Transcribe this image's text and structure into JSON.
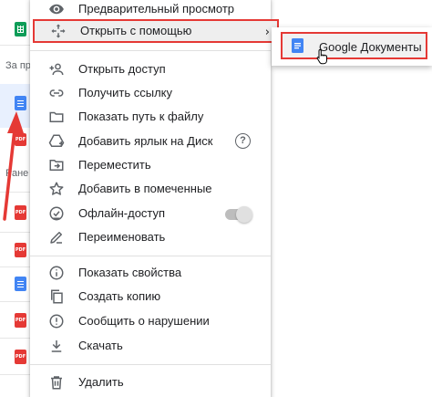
{
  "background": {
    "section_labels": [
      "За пр",
      "Ране"
    ]
  },
  "menu": {
    "items": [
      {
        "label": "Предварительный просмотр",
        "icon": "eye-icon"
      },
      {
        "label": "Открыть с помощью",
        "icon": "move-arrows-icon",
        "submenu_indicator": "›"
      },
      {
        "label": "Открыть доступ",
        "icon": "person-add-icon"
      },
      {
        "label": "Получить ссылку",
        "icon": "link-icon"
      },
      {
        "label": "Показать путь к файлу",
        "icon": "folder-icon"
      },
      {
        "label": "Добавить ярлык на Диск",
        "icon": "drive-shortcut-icon",
        "help": "?"
      },
      {
        "label": "Переместить",
        "icon": "move-to-icon"
      },
      {
        "label": "Добавить в помеченные",
        "icon": "star-icon"
      },
      {
        "label": "Офлайн-доступ",
        "icon": "offline-check-icon",
        "toggle_on": false
      },
      {
        "label": "Переименовать",
        "icon": "pencil-icon"
      },
      {
        "label": "Показать свойства",
        "icon": "info-icon"
      },
      {
        "label": "Создать копию",
        "icon": "copy-icon"
      },
      {
        "label": "Сообщить о нарушении",
        "icon": "report-icon"
      },
      {
        "label": "Скачать",
        "icon": "download-icon"
      },
      {
        "label": "Удалить",
        "icon": "trash-icon"
      }
    ]
  },
  "submenu": {
    "item_label": "Google Документы",
    "item_icon": "google-docs-icon"
  },
  "colors": {
    "highlight_border": "#e53935",
    "docs_blue": "#4285f4",
    "icon_gray": "#5f6368"
  }
}
